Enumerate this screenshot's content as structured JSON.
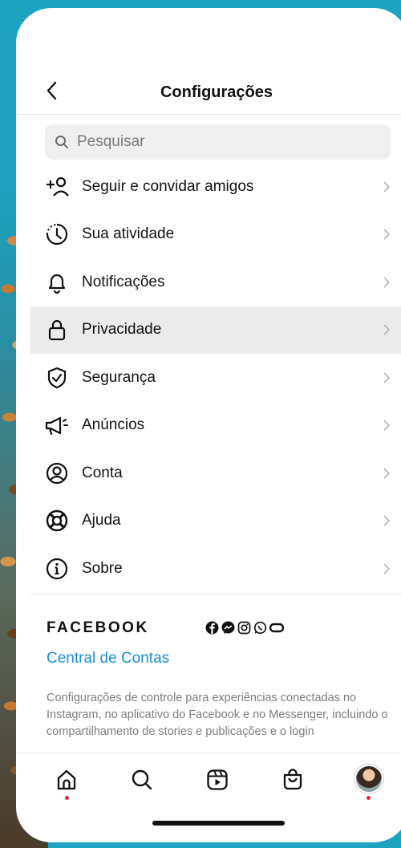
{
  "header": {
    "title": "Configurações",
    "back_icon": "chevron-left-icon"
  },
  "search": {
    "placeholder": "Pesquisar",
    "value": ""
  },
  "menu": {
    "items": [
      {
        "label": "Seguir e convidar amigos",
        "icon": "add-person-icon",
        "selected": false
      },
      {
        "label": "Sua atividade",
        "icon": "activity-clock-icon",
        "selected": false
      },
      {
        "label": "Notificações",
        "icon": "bell-icon",
        "selected": false
      },
      {
        "label": "Privacidade",
        "icon": "lock-icon",
        "selected": true
      },
      {
        "label": "Segurança",
        "icon": "shield-check-icon",
        "selected": false
      },
      {
        "label": "Anúncios",
        "icon": "megaphone-icon",
        "selected": false
      },
      {
        "label": "Conta",
        "icon": "account-circle-icon",
        "selected": false
      },
      {
        "label": "Ajuda",
        "icon": "lifebuoy-icon",
        "selected": false
      },
      {
        "label": "Sobre",
        "icon": "info-icon",
        "selected": false
      }
    ]
  },
  "facebook": {
    "title": "FACEBOOK",
    "app_icons": [
      "facebook-icon",
      "messenger-icon",
      "instagram-icon",
      "whatsapp-icon",
      "oculus-icon"
    ],
    "accounts_link": "Central de Contas",
    "description": "Configurações de controle para experiências conectadas no Instagram, no aplicativo do Facebook e no Messenger, incluindo o compartilhamento de stories e publicações e o login"
  },
  "bottom_nav": {
    "items": [
      "home-icon",
      "search-icon",
      "reels-icon",
      "shop-icon",
      "profile-avatar"
    ],
    "notification_dots": [
      "home",
      "profile"
    ]
  },
  "colors": {
    "accent_link": "#1a8fd8",
    "notification_dot": "#e4233f",
    "background": "#1ba3bf"
  }
}
